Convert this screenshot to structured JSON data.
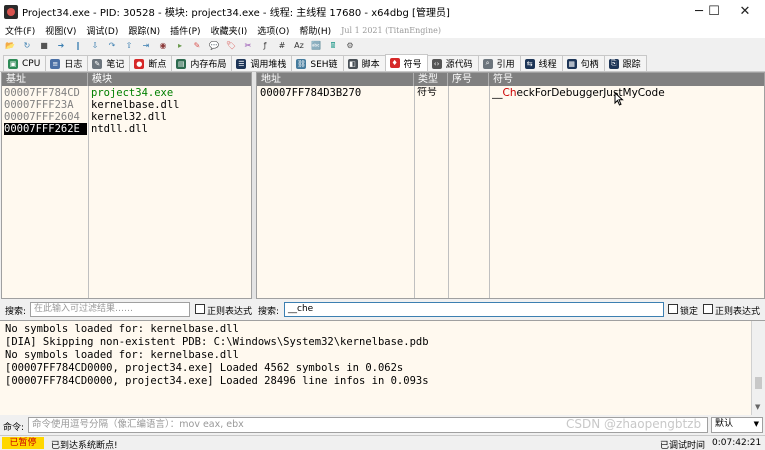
{
  "window": {
    "title": "Project34.exe - PID: 30528 - 模块: project34.exe - 线程: 主线程 17680 - x64dbg [管理员]",
    "minimize": "─",
    "maximize": "☐",
    "close": "✕"
  },
  "menu": {
    "items": [
      "文件(F)",
      "视图(V)",
      "调试(D)",
      "跟踪(N)",
      "插件(P)",
      "收藏夹(I)",
      "选项(O)",
      "帮助(H)"
    ],
    "build_info": "Jul 1 2021 (TitanEngine)"
  },
  "toolbar": {
    "icons": [
      "open-icon",
      "restart-icon",
      "close-icon",
      "run-icon",
      "pause-icon",
      "step-into-icon",
      "step-over-icon",
      "execute-till-return-icon",
      "run-to-user-code-icon",
      "trace-icon",
      "animate-icon",
      "patch-icon",
      "comment-icon",
      "label-icon",
      "bookmark-icon",
      "function-icon",
      "hash-icon",
      "font-icon",
      "strings-icon",
      "calculator-icon",
      "settings-icon"
    ],
    "glyphs": [
      "📂",
      "↻",
      "■",
      "➜",
      "‖",
      "⇩",
      "↷",
      "⇧",
      "⇥",
      "◉",
      "▸",
      "✎",
      "💬",
      "🏷",
      "✂",
      "ƒ",
      "#",
      "Az",
      "🔤",
      "🖩",
      "⚙"
    ]
  },
  "tabs": [
    {
      "label": "CPU",
      "icon": "cpu-icon",
      "color": "#2e8b57",
      "glyph": "▣"
    },
    {
      "label": "日志",
      "icon": "log-icon",
      "color": "#4a6fa5",
      "glyph": "≡"
    },
    {
      "label": "笔记",
      "icon": "notes-icon",
      "color": "#6c757d",
      "glyph": "✎"
    },
    {
      "label": "断点",
      "icon": "breakpoint-icon",
      "color": "#d62828",
      "glyph": "●"
    },
    {
      "label": "内存布局",
      "icon": "memory-map-icon",
      "color": "#2d6a4f",
      "glyph": "▤"
    },
    {
      "label": "调用堆栈",
      "icon": "call-stack-icon",
      "color": "#1d3557",
      "glyph": "☰"
    },
    {
      "label": "SEH链",
      "icon": "seh-icon",
      "color": "#457b9d",
      "glyph": "⛓"
    },
    {
      "label": "脚本",
      "icon": "script-icon",
      "color": "#495057",
      "glyph": "◧"
    },
    {
      "label": "符号",
      "icon": "symbols-icon",
      "color": "#d62828",
      "glyph": "♦"
    },
    {
      "label": "源代码",
      "icon": "source-icon",
      "color": "#555555",
      "glyph": "‹›"
    },
    {
      "label": "引用",
      "icon": "references-icon",
      "color": "#6c757d",
      "glyph": "⌕"
    },
    {
      "label": "线程",
      "icon": "threads-icon",
      "color": "#1d3557",
      "glyph": "⇆"
    },
    {
      "label": "句柄",
      "icon": "handles-icon",
      "color": "#1d3557",
      "glyph": "▦"
    },
    {
      "label": "跟踪",
      "icon": "trace-tab-icon",
      "color": "#1d3557",
      "glyph": "⎘"
    }
  ],
  "active_tab": "符号",
  "modules": {
    "headers": [
      "基址",
      "模块"
    ],
    "rows": [
      {
        "base": "00007FF784CD",
        "module": "project34.exe",
        "selected": true
      },
      {
        "base": "00007FFF23A",
        "module": "kernelbase.dll",
        "selected": false
      },
      {
        "base": "00007FFF2604",
        "module": "kernel32.dll",
        "selected": false
      },
      {
        "base": "00007FFF262E",
        "module": "ntdll.dll",
        "selected": false
      }
    ]
  },
  "symbols": {
    "headers": [
      "地址",
      "类型",
      "序号",
      "符号"
    ],
    "rows": [
      {
        "address": "00007FF784D3B270",
        "type": "符号",
        "ordinal": "",
        "symbol_prefix": "__",
        "symbol_match": "Ch",
        "symbol_rest": "eckForDebuggerJustMyCode"
      }
    ]
  },
  "search": {
    "label_left": "搜索:",
    "placeholder_left": "在此输入可过滤结果……",
    "regex_left": "正则表达式",
    "label_right": "搜索:",
    "value_right": "__che",
    "lock": "锁定",
    "regex_right": "正则表达式"
  },
  "log": {
    "lines": [
      "No symbols loaded for: kernelbase.dll",
      "[DIA] Skipping non-existent PDB: C:\\Windows\\System32\\kernelbase.pdb",
      "No symbols loaded for: kernelbase.dll",
      "[00007FF784CD0000, project34.exe] Loaded 4562 symbols in 0.062s",
      "[00007FF784CD0000, project34.exe] Loaded 28496 line infos in 0.093s"
    ]
  },
  "command": {
    "label": "命令:",
    "placeholder": "命令使用逗号分隔（像汇编语言）：mov eax, ebx",
    "default_label": "默认"
  },
  "status": {
    "state": "已暂停",
    "message": "已到达系统断点!",
    "watermark": "CSDN @zhaopengbtzb",
    "time_label": "已调试时间",
    "time_value": "0:07:42:21"
  },
  "colors": {
    "panel_bg": "#fff9ef",
    "header_bg": "#808080",
    "selected_bg": "#000000",
    "address_gray": "#808080",
    "module_green": "#008000",
    "symbol_match_red": "#cc0000",
    "paused_bg": "#ffd700",
    "paused_fg": "#cc0000"
  }
}
